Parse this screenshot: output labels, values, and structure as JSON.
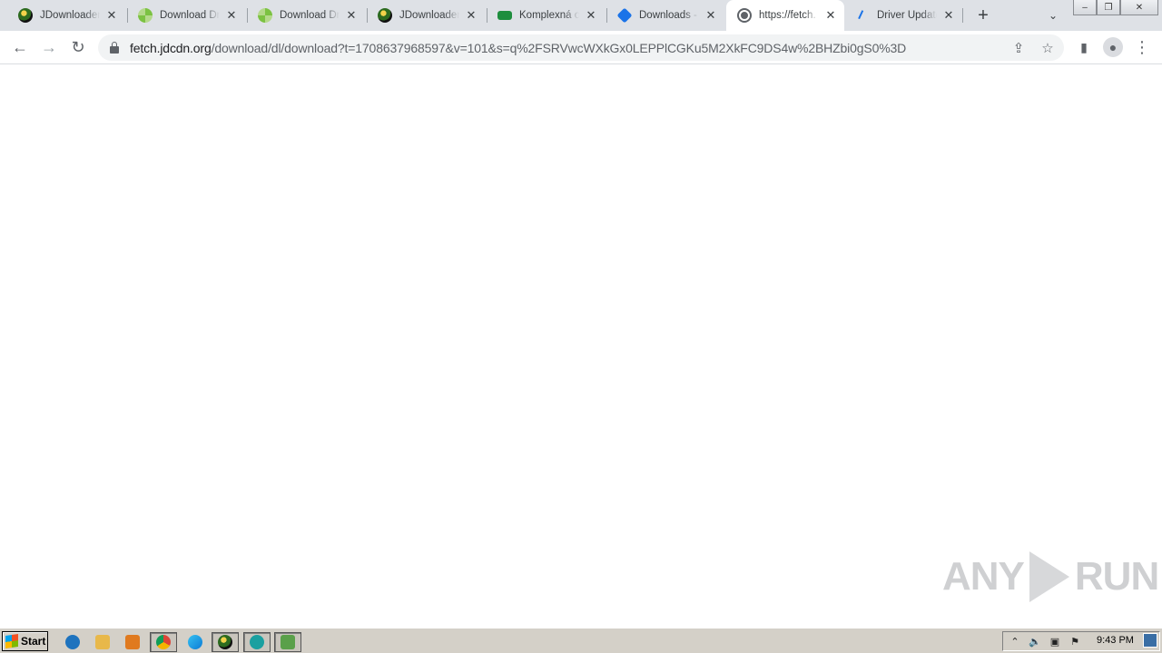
{
  "browser": {
    "tabs": [
      {
        "title": "JDownloader",
        "favicon": "jdownloader-icon",
        "active": false
      },
      {
        "title": "Download Driv",
        "favicon": "drivers-icon",
        "active": false
      },
      {
        "title": "Download Driv",
        "favicon": "drivers-icon",
        "active": false
      },
      {
        "title": "JDownloader",
        "favicon": "jdownloader-icon",
        "active": false
      },
      {
        "title": "Komplexná oc",
        "favicon": "komplexna-icon",
        "active": false
      },
      {
        "title": "Downloads - S",
        "favicon": "downloads-icon",
        "active": false
      },
      {
        "title": "https://fetch.",
        "favicon": "globe-icon",
        "active": true
      },
      {
        "title": "Driver Update",
        "favicon": "driver-update-icon",
        "active": false
      }
    ],
    "close_glyph": "✕",
    "new_tab_glyph": "+",
    "tab_search_glyph": "⌄",
    "window_controls": {
      "minimize": "–",
      "restore": "❐",
      "close": "✕"
    },
    "toolbar": {
      "back": "←",
      "forward": "→",
      "reload": "↻"
    },
    "address": {
      "host": "fetch.jdcdn.org",
      "path": "/download/dl/download?t=1708637968597&v=101&s=q%2FSRVwcWXkGx0LEPPlCGKu5M2XkFC9DS4w%2BHZbi0gS0%3D"
    },
    "omni_icons": {
      "share": "⇪",
      "bookmark": "☆"
    },
    "side_panel": "▮",
    "profile": "●",
    "menu": "⋮"
  },
  "watermark": {
    "left": "ANY",
    "right": "RUN"
  },
  "taskbar": {
    "start_label": "Start",
    "clock": "9:43 PM",
    "quicklaunch": [
      {
        "name": "ie-icon",
        "color": "#1e73be"
      },
      {
        "name": "explorer-folder-icon",
        "color": "#e8b84a"
      },
      {
        "name": "media-player-icon",
        "color": "#e07a1f"
      }
    ],
    "running": [
      {
        "name": "chrome-icon",
        "color": "#db4437",
        "pressed": true
      },
      {
        "name": "edge-icon",
        "color": "#0c7bd6",
        "pressed": false
      },
      {
        "name": "jdownloader-task-icon",
        "color": "#2d6b1f",
        "pressed": true
      },
      {
        "name": "ie-task-icon",
        "color": "#1aa0a0",
        "pressed": true
      },
      {
        "name": "installer-task-icon",
        "color": "#5aa04a",
        "pressed": true
      }
    ],
    "tray": {
      "show_hidden": "⌃",
      "volume": "🔈",
      "network": "▣",
      "action_center": "⚑"
    }
  }
}
